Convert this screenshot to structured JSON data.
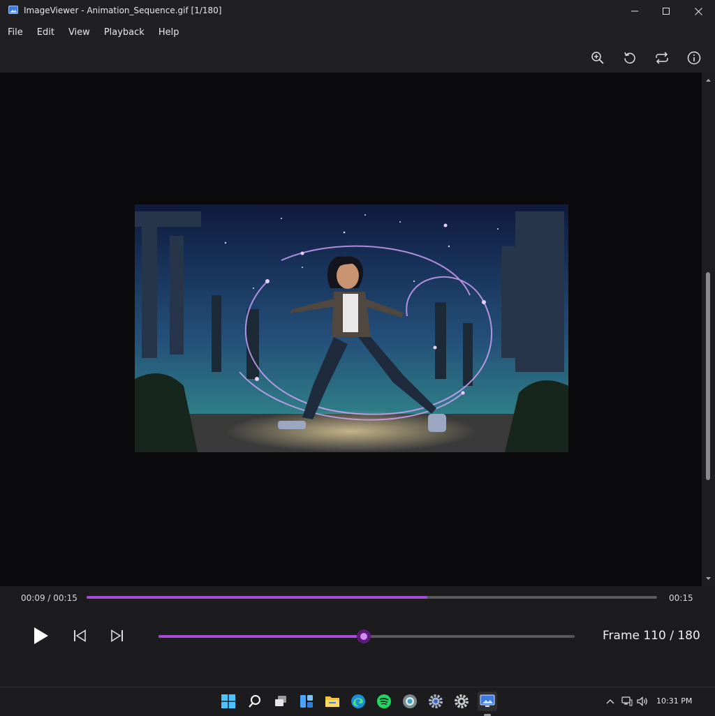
{
  "window": {
    "app_name": "ImageViewer",
    "title": "ImageViewer - Animation_Sequence.gif [1/180]"
  },
  "menu": [
    "File",
    "Edit",
    "View",
    "Playback",
    "Help"
  ],
  "toolbar": {
    "icons": [
      "zoom-in-icon",
      "rotate-icon",
      "loop-icon",
      "info-icon"
    ]
  },
  "image": {
    "file_name": "Animation_Sequence.gif",
    "subject": "anime girl casting a sparkling magic spell in night ruins"
  },
  "playback": {
    "current_time": "00:09 / 00:15",
    "end_time": "00:15",
    "time_progress": 0.597,
    "frame_label": "Frame 110 / 180",
    "current_frame": 110,
    "total_frames": 180,
    "frame_progress": 0.493,
    "accent_color": "#a64bd6"
  },
  "taskbar": {
    "time": "10:31 PM",
    "apps": [
      "start-icon",
      "search-icon",
      "task-view-icon",
      "widgets-icon",
      "file-explorer-icon",
      "edge-icon",
      "spotify-icon",
      "chrome-icon",
      "settings-icon",
      "settings-gear-icon",
      "image-viewer-icon"
    ]
  }
}
